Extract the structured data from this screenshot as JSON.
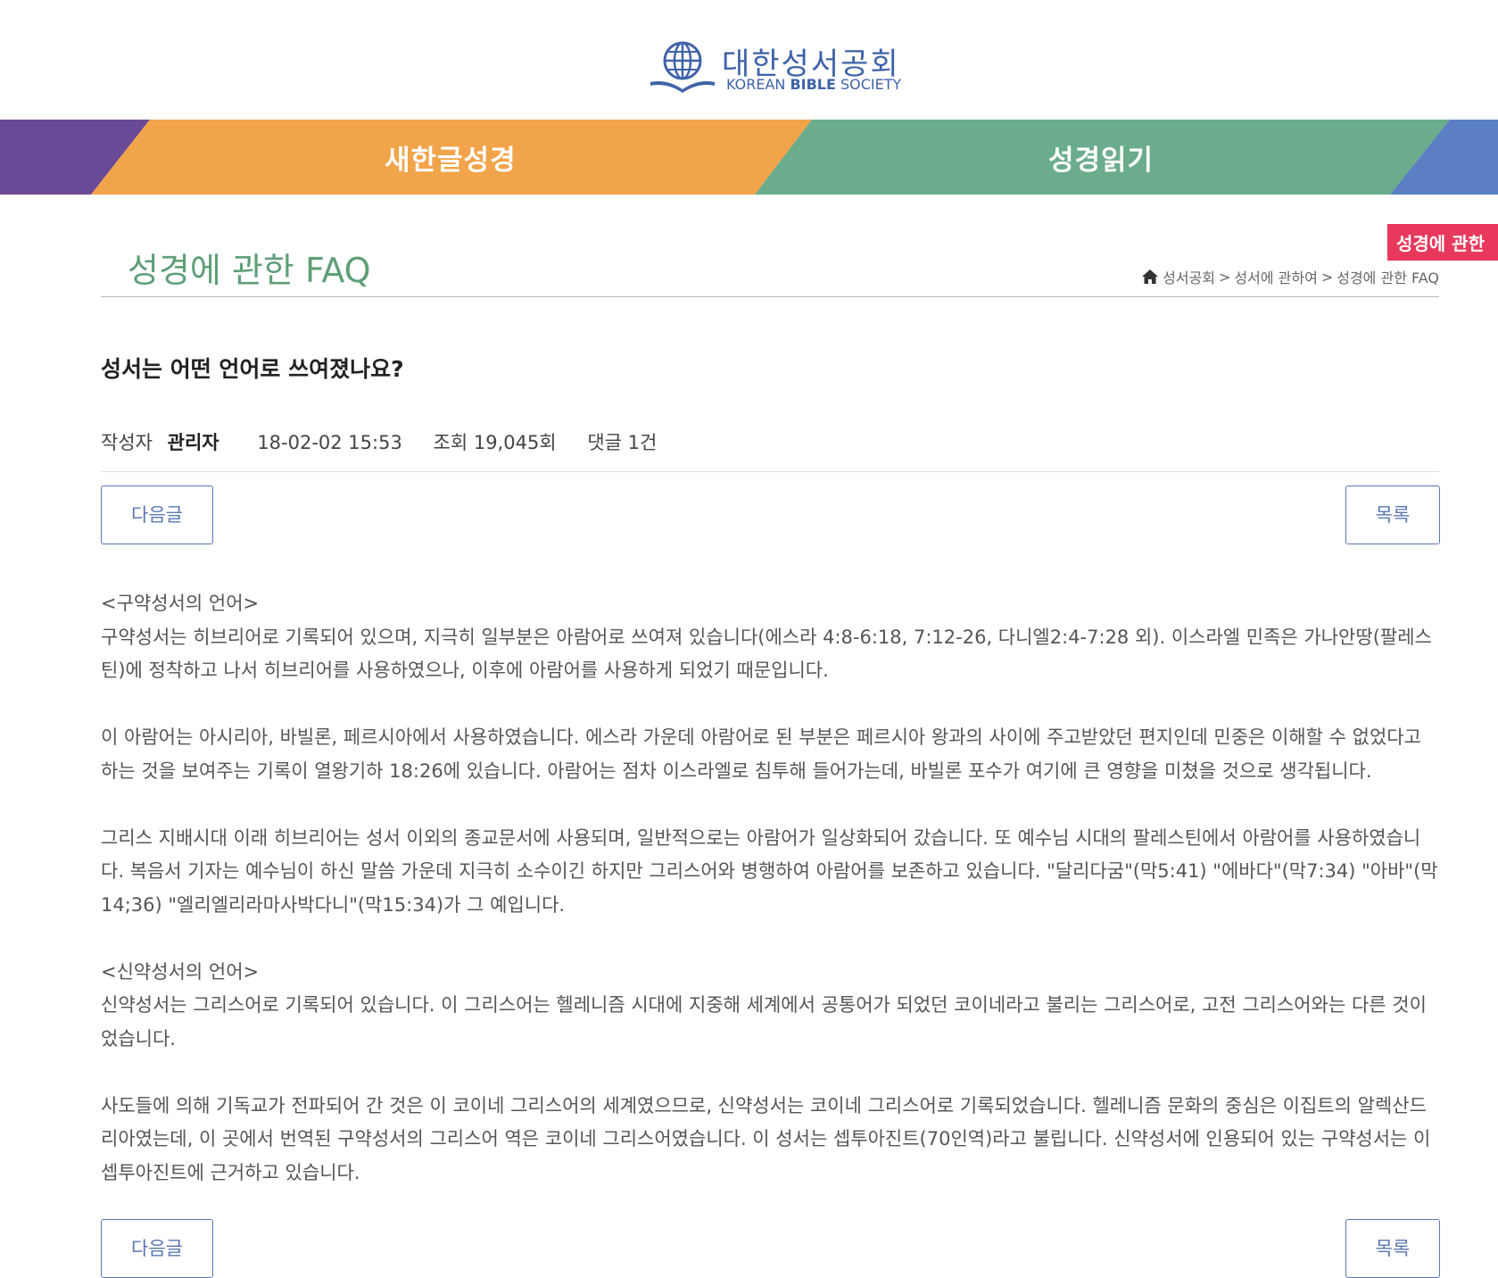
{
  "logo": {
    "name_ko": "대한성서공회",
    "name_en_prefix": "KOREAN ",
    "name_en_bold": "BIBLE",
    "name_en_suffix": " SOCIETY"
  },
  "nav": {
    "items": [
      {
        "label": "새한글성경"
      },
      {
        "label": "성경읽기"
      }
    ]
  },
  "side_badge": "성경에 관한",
  "page_title": "성경에 관한 FAQ",
  "breadcrumb": {
    "items": [
      "성서공회",
      "성서에 관하여",
      "성경에 관한 FAQ"
    ],
    "separator": ">"
  },
  "post": {
    "title": "성서는 어떤 언어로 쓰여졌나요?",
    "author_label": "작성자",
    "author": "관리자",
    "date": "18-02-02 15:53",
    "views": "조회 19,045회",
    "comments": "댓글 1건"
  },
  "buttons": {
    "next": "다음글",
    "list": "목록"
  },
  "content": {
    "ot_heading": "<구약성서의 언어>",
    "ot_p1": "구약성서는 히브리어로 기록되어 있으며, 지극히 일부분은 아람어로 쓰여져 있습니다(에스라 4:8-6:18, 7:12-26, 다니엘2:4-7:28 외). 이스라엘 민족은 가나안땅(팔레스틴)에 정착하고 나서 히브리어를 사용하였으나, 이후에 아람어를 사용하게 되었기 때문입니다.",
    "ot_p2": "이 아람어는 아시리아, 바빌론, 페르시아에서 사용하였습니다. 에스라 가운데 아람어로 된 부분은 페르시아 왕과의 사이에 주고받았던 편지인데 민중은 이해할 수 없었다고 하는 것을 보여주는 기록이 열왕기하 18:26에 있습니다. 아람어는 점차 이스라엘로 침투해 들어가는데, 바빌론 포수가 여기에 큰 영향을 미쳤을 것으로 생각됩니다.",
    "ot_p3": "그리스 지배시대 이래 히브리어는 성서 이외의 종교문서에 사용되며, 일반적으로는 아람어가 일상화되어 갔습니다. 또 예수님 시대의 팔레스틴에서 아람어를 사용하였습니다. 복음서 기자는 예수님이 하신 말씀 가운데 지극히 소수이긴 하지만 그리스어와 병행하여 아람어를 보존하고 있습니다. \"달리다굼\"(막5:41) \"에바다\"(막7:34) \"아바\"(막14;36) \"엘리엘리라마사박다니\"(막15:34)가 그 예입니다.",
    "nt_heading": "<신약성서의 언어>",
    "nt_p1": "신약성서는 그리스어로 기록되어 있습니다. 이 그리스어는 헬레니즘 시대에 지중해 세계에서 공통어가 되었던 코이네라고 불리는 그리스어로, 고전 그리스어와는 다른 것이었습니다.",
    "nt_p2": "사도들에 의해 기독교가 전파되어 간 것은 이 코이네 그리스어의 세계였으므로, 신약성서는 코이네 그리스어로 기록되었습니다. 헬레니즘 문화의 중심은 이집트의 알렉산드리아였는데, 이 곳에서 번역된 구약성서의 그리스어 역은 코이네 그리스어였습니다. 이 성서는 셉투아진트(70인역)라고 불립니다. 신약성서에 인용되어 있는 구약성서는 이 셉투아진트에 근거하고 있습니다."
  },
  "colors": {
    "purple": "#6a4a96",
    "orange": "#f2a44a",
    "green": "#6aac8c",
    "blue": "#5b7fc2",
    "title_green": "#5f9f78",
    "badge_red": "#e8395d",
    "button_blue": "#5a77b2"
  }
}
